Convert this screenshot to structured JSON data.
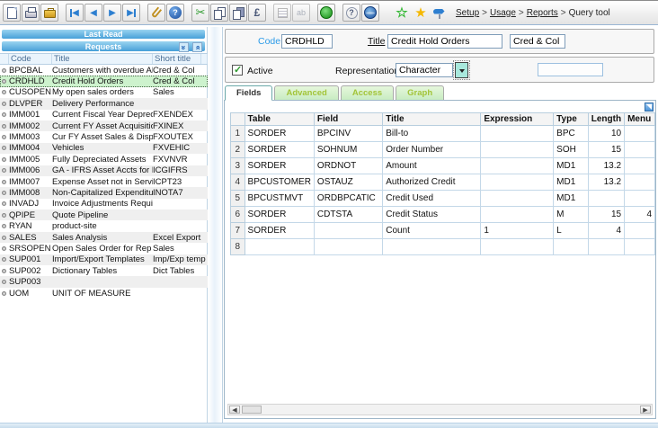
{
  "colors": {
    "selection_green": "#cdf2cd",
    "header_bar_blue": "#47a0d8",
    "tab_inactive_text": "#a2c438",
    "code_label_blue": "#2c9be8"
  },
  "toolbar": {
    "icons": [
      "save-icon",
      "print-icon",
      "briefcase-icon",
      "first-record-icon",
      "previous-record-icon",
      "next-record-icon",
      "last-record-icon",
      "paperclip-icon",
      "help-ball-icon",
      "cut-icon",
      "copy-icon",
      "paste-icon",
      "currency-icon",
      "list-icon",
      "text-ab-icon",
      "green-globe-icon",
      "question-icon",
      "globe-icon",
      "green-star-icon",
      "yellow-star-icon",
      "signpost-icon"
    ]
  },
  "breadcrumb": {
    "separator": ">",
    "items": [
      {
        "label": "Setup",
        "link": true
      },
      {
        "label": "Usage",
        "link": true
      },
      {
        "label": "Reports",
        "link": true
      },
      {
        "label": "Query tool",
        "link": false
      }
    ]
  },
  "left_panel": {
    "last_read_header": "Last Read",
    "requests_header": "Requests",
    "columns": [
      "Code",
      "Title",
      "Short title"
    ],
    "items": [
      {
        "code": "BPCBAL",
        "title": "Customers with overdue AR",
        "short_title": "Cred & Col"
      },
      {
        "code": "CRDHLD",
        "title": "Credit Hold Orders",
        "short_title": "Cred & Col",
        "selected": true
      },
      {
        "code": "CUSOPEN",
        "title": "My open sales orders",
        "short_title": "Sales"
      },
      {
        "code": "DLVPER",
        "title": "Delivery Performance",
        "short_title": ""
      },
      {
        "code": "IMM001",
        "title": "Current Fiscal Year Deprec",
        "short_title": "FXENDEX"
      },
      {
        "code": "IMM002",
        "title": "Current FY Asset Acquisition",
        "short_title": "FXINEX"
      },
      {
        "code": "IMM003",
        "title": "Cur FY Asset Sales & Disposal",
        "short_title": "FXOUTEX"
      },
      {
        "code": "IMM004",
        "title": "Vehicles",
        "short_title": "FXVEHIC"
      },
      {
        "code": "IMM005",
        "title": "Fully Depreciated Assets",
        "short_title": "FXVNVR"
      },
      {
        "code": "IMM006",
        "title": "GA - IFRS Asset Accts for Exp",
        "short_title": "ICGIFRS"
      },
      {
        "code": "IMM007",
        "title": "Expense Asset not in Service",
        "short_title": "ICPT23"
      },
      {
        "code": "IMM008",
        "title": "Non-Capitalized Expenditures",
        "short_title": "INOTA7"
      },
      {
        "code": "INVADJ",
        "title": "Invoice Adjustments Required",
        "short_title": ""
      },
      {
        "code": "QPIPE",
        "title": "Quote Pipeline",
        "short_title": ""
      },
      {
        "code": "RYAN",
        "title": "product-site",
        "short_title": ""
      },
      {
        "code": "SALES",
        "title": "Sales Analysis",
        "short_title": "Excel Export"
      },
      {
        "code": "SRSOPEN",
        "title": "Open Sales Order for Rep",
        "short_title": "Sales"
      },
      {
        "code": "SUP001",
        "title": "Import/Export Templates",
        "short_title": "Imp/Exp temp"
      },
      {
        "code": "SUP002",
        "title": "Dictionary Tables",
        "short_title": "Dict Tables"
      },
      {
        "code": "SUP003",
        "title": "",
        "short_title": ""
      },
      {
        "code": "UOM",
        "title": "UNIT OF MEASURE",
        "short_title": ""
      }
    ]
  },
  "form": {
    "code_label": "Code",
    "code_value": "CRDHLD",
    "title_label": "Title",
    "title_value": "Credit Hold Orders",
    "short_title_value": "Cred & Col",
    "active_label": "Active",
    "active_checked": true,
    "representation_label": "Representation",
    "representation_value": "Character"
  },
  "tabs": [
    {
      "label": "Fields",
      "active": true
    },
    {
      "label": "Advanced",
      "active": false
    },
    {
      "label": "Access",
      "active": false
    },
    {
      "label": "Graph",
      "active": false
    }
  ],
  "grid": {
    "columns": [
      "Table",
      "Field",
      "Title",
      "Expression",
      "Type",
      "Length",
      "Menu"
    ],
    "rows": [
      {
        "table": "SORDER",
        "field": "BPCINV",
        "title": "Bill-to",
        "expression": "",
        "type": "BPC",
        "length": "10",
        "menu": ""
      },
      {
        "table": "SORDER",
        "field": "SOHNUM",
        "title": "Order Number",
        "expression": "",
        "type": "SOH",
        "length": "15",
        "menu": ""
      },
      {
        "table": "SORDER",
        "field": "ORDNOT",
        "title": "Amount",
        "expression": "",
        "type": "MD1",
        "length": "13.2",
        "menu": ""
      },
      {
        "table": "BPCUSTOMER",
        "field": "OSTAUZ",
        "title": "Authorized Credit",
        "expression": "",
        "type": "MD1",
        "length": "13.2",
        "menu": ""
      },
      {
        "table": "BPCUSTMVT",
        "field": "ORDBPCATIC",
        "title": "Credit Used",
        "expression": "",
        "type": "MD1",
        "length": "",
        "menu": ""
      },
      {
        "table": "SORDER",
        "field": "CDTSTA",
        "title": "Credit Status",
        "expression": "",
        "type": "M",
        "length": "15",
        "menu": "4"
      },
      {
        "table": "SORDER",
        "field": "",
        "title": "Count",
        "expression": "1",
        "type": "L",
        "length": "4",
        "menu": ""
      },
      {
        "table": "",
        "field": "",
        "title": "",
        "expression": "",
        "type": "",
        "length": "",
        "menu": ""
      }
    ]
  }
}
